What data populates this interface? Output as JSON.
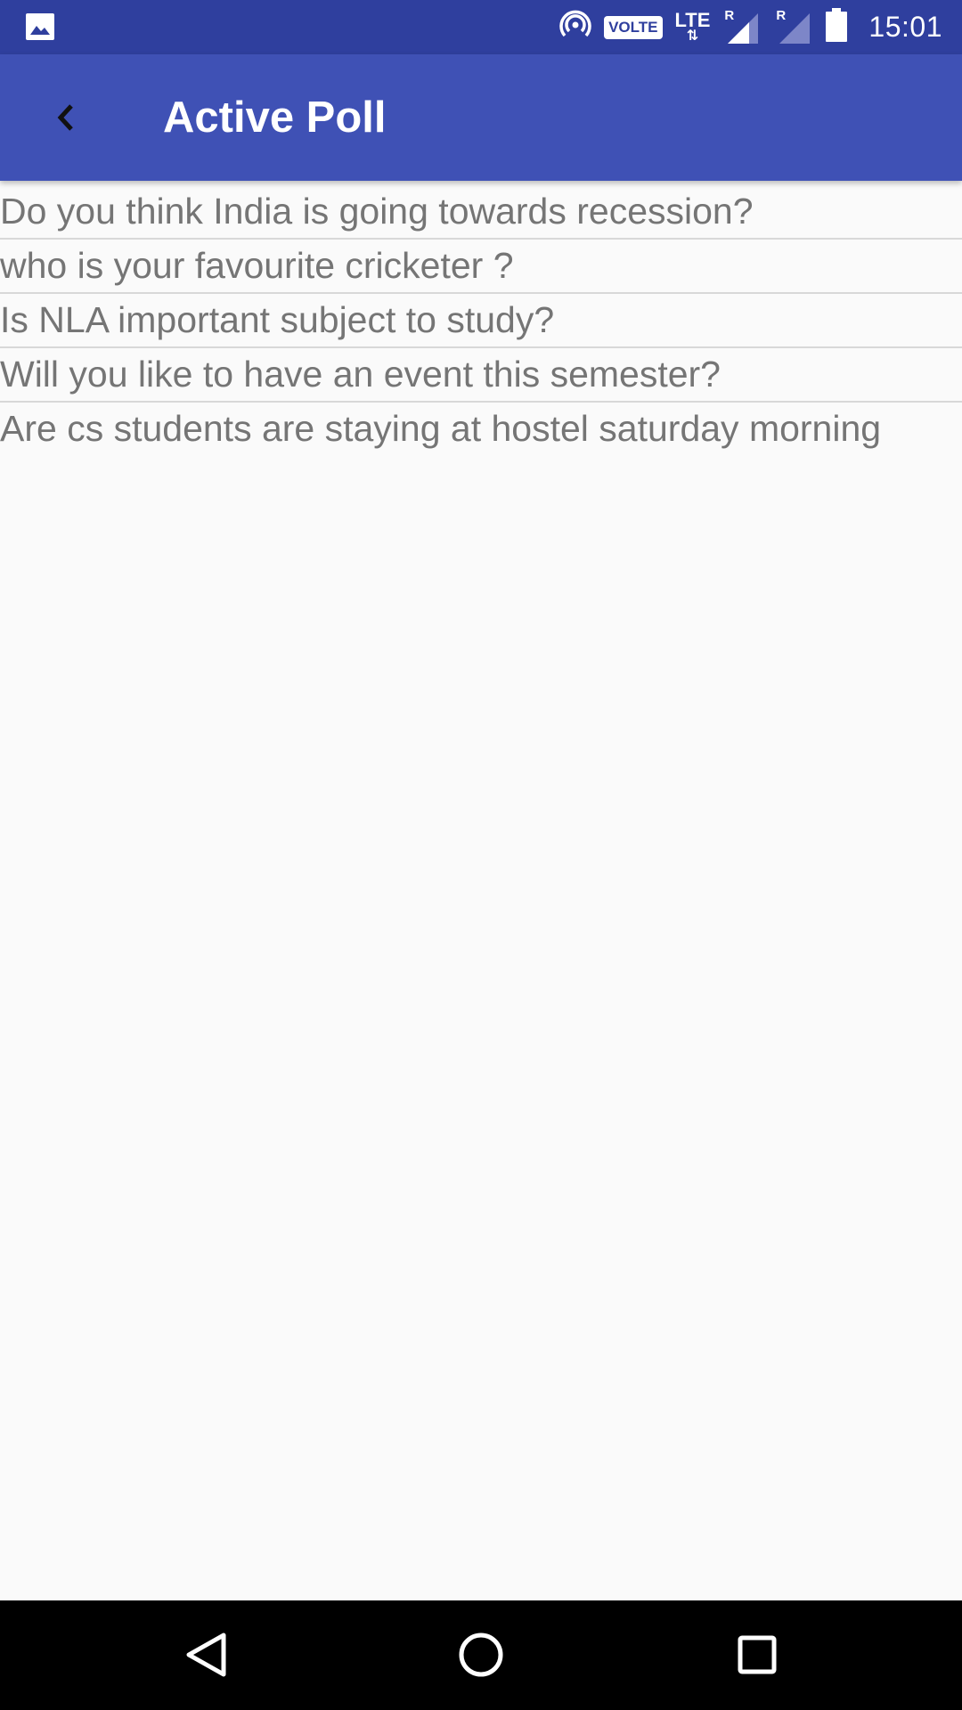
{
  "status_bar": {
    "time": "15:01",
    "volte": "VOLTE",
    "lte": "LTE",
    "lte_arrows": "⇅",
    "roaming_1": "R",
    "roaming_2": "R"
  },
  "app_bar": {
    "title": "Active Poll"
  },
  "polls": [
    "Do you think India is going towards recession?",
    "who is your favourite cricketer ?",
    "Is NLA important subject to study?",
    "Will you like to have an event this semester?",
    "Are cs students are staying at hostel saturday morning"
  ],
  "colors": {
    "status_bar": "#2f3f9e",
    "app_bar": "#3f51b5",
    "background": "#fafafa",
    "item_text": "#757575",
    "divider": "#d8d8d8"
  },
  "icons": {
    "status_left": "image-icon",
    "hotspot": "hotspot-icon",
    "signal": "signal-icon",
    "battery": "battery-icon",
    "back": "back-arrow-icon",
    "nav_back": "nav-back-icon",
    "nav_home": "nav-home-icon",
    "nav_recents": "nav-recents-icon"
  }
}
